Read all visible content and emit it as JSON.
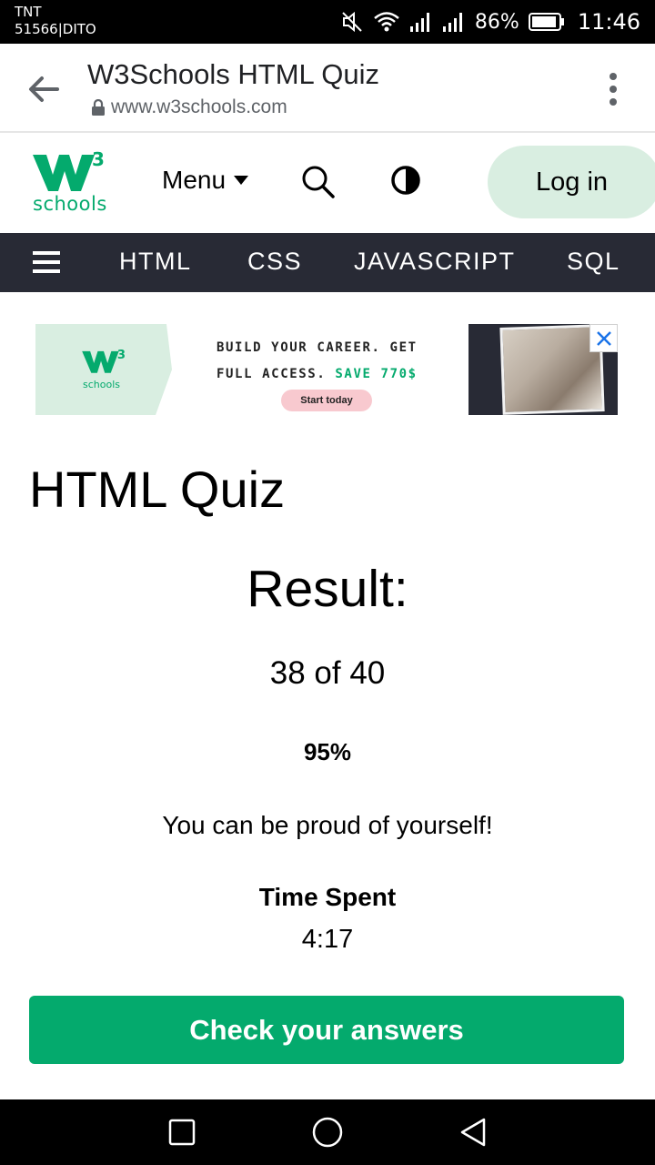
{
  "status_bar": {
    "carrier": "TNT",
    "carrier_code": "51566|DITO",
    "battery_percent": "86%",
    "time": "11:46",
    "icons": [
      "mute-icon",
      "wifi-icon",
      "signal-icon",
      "signal-icon",
      "battery-icon"
    ]
  },
  "browser": {
    "page_title": "W3Schools HTML Quiz",
    "url": "www.w3schools.com",
    "icons": [
      "back-arrow-icon",
      "lock-icon",
      "more-vert-icon"
    ]
  },
  "header": {
    "logo_superscript": "3",
    "logo_text": "schools",
    "menu_label": "Menu",
    "login_label": "Log in",
    "icons": [
      "caret-down-icon",
      "search-icon",
      "contrast-icon"
    ],
    "brand_color": "#04AA6D",
    "login_bg": "#D9EEE1"
  },
  "topnav": {
    "items": [
      "HTML",
      "CSS",
      "JAVASCRIPT",
      "SQL"
    ],
    "bg_color": "#282A35"
  },
  "ad": {
    "logo_superscript": "3",
    "logo_text": "schools",
    "line1": "BUILD YOUR CAREER. GET",
    "line2_prefix": "FULL ACCESS.",
    "line2_accent": "SAVE 770$",
    "cta": "Start today",
    "close_icon": "close-icon"
  },
  "quiz": {
    "heading": "HTML Quiz",
    "result_label": "Result:",
    "score": "38 of 40",
    "percent": "95%",
    "message": "You can be proud of yourself!",
    "time_label": "Time Spent",
    "time_value": "4:17",
    "check_button": "Check your answers",
    "button_color": "#04AA6D"
  },
  "android_nav": {
    "icons": [
      "recents-icon",
      "home-icon",
      "back-icon"
    ]
  }
}
